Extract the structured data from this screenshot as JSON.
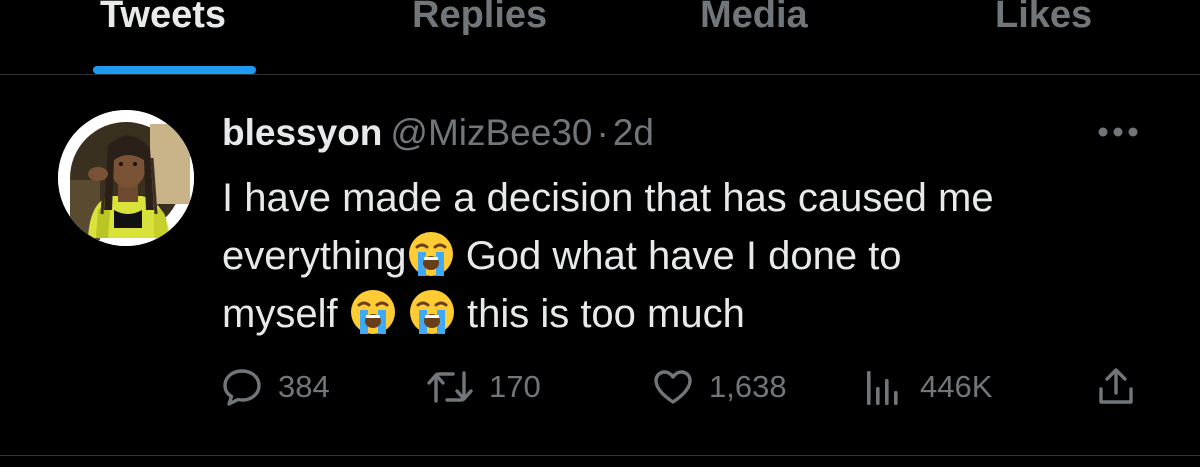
{
  "tabs": [
    {
      "label": "Tweets",
      "active": true
    },
    {
      "label": "Replies",
      "active": false
    },
    {
      "label": "Media",
      "active": false
    },
    {
      "label": "Likes",
      "active": false
    }
  ],
  "tweet": {
    "display_name": "blessyon",
    "handle": "@MizBee30",
    "separator": "·",
    "time": "2d",
    "text_line1": "I have made a decision that has caused me",
    "text_line2a": "everything",
    "text_line2b": "God what have I done to",
    "text_line3a": "myself",
    "text_line3b": "this is too much",
    "emoji": "loudly-crying-face",
    "more_icon": "more-horizontal-icon"
  },
  "actions": {
    "reply_count": "384",
    "retweet_count": "170",
    "like_count": "1,638",
    "view_count": "446K",
    "share_icon": "share-icon"
  },
  "colors": {
    "background": "#000000",
    "text_primary": "#e7e9ea",
    "text_secondary": "#71767b",
    "accent": "#1d9bf0",
    "divider": "#2f3336"
  }
}
